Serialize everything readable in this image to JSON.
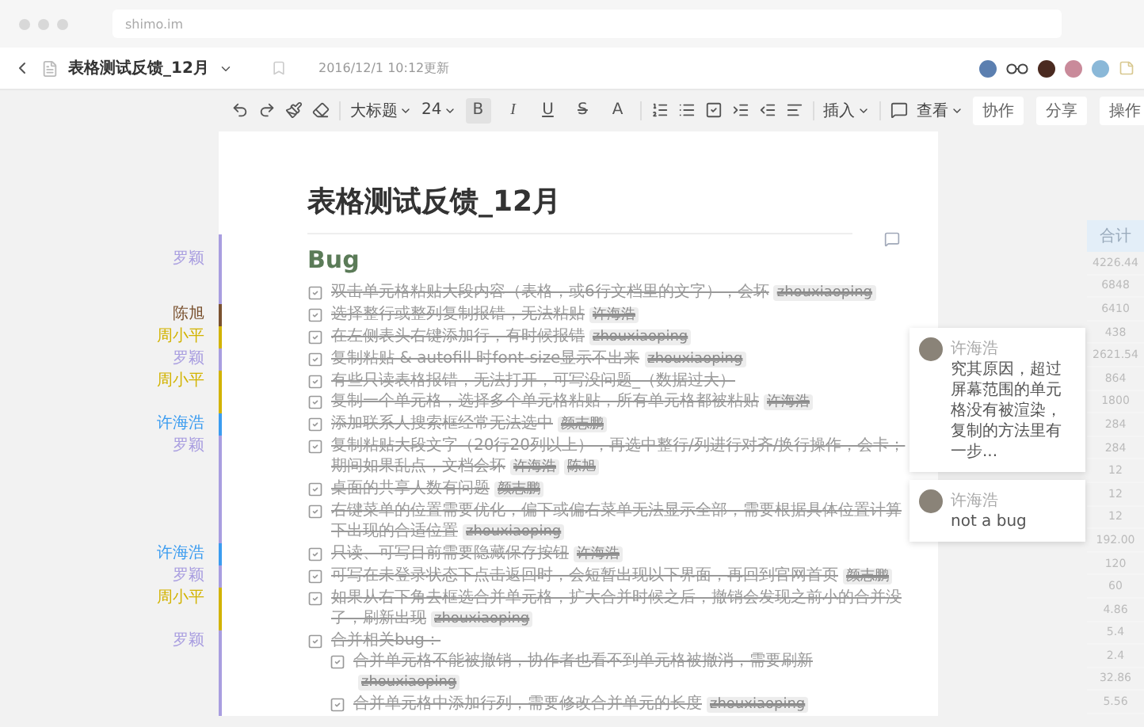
{
  "browser": {
    "url": "shimo.im"
  },
  "header": {
    "title": "表格测试反馈_12月",
    "updated": "2016/12/1 10:12更新"
  },
  "toolbar": {
    "style": "大标题",
    "size": "24",
    "formats": [
      {
        "label": "B",
        "selected": true
      },
      {
        "label": "I",
        "selected": false
      },
      {
        "label": "U",
        "selected": false
      },
      {
        "label": "S",
        "selected": false
      },
      {
        "label": "A",
        "selected": false
      }
    ],
    "insert": "插入",
    "view": "查看",
    "buttons": [
      "协作",
      "分享",
      "操作"
    ]
  },
  "document": {
    "title": "表格测试反馈_12月",
    "heading": {
      "text": "Bug",
      "color": "#a99ee0",
      "author": "罗颖"
    },
    "items": [
      {
        "text": "双击单元格粘贴大段内容（表格，或6行文档里的文字），会坏",
        "checked": true,
        "tags": [
          "zhouxiaoping"
        ],
        "color": "#a99ee0"
      },
      {
        "text": "选择整行或整列复制报错，无法粘贴",
        "checked": true,
        "tags": [
          "许海浩"
        ],
        "color": "#7a5230",
        "author": "陈旭"
      },
      {
        "text": "在左侧表头右键添加行，有时候报错",
        "checked": true,
        "tags": [
          "zhouxiaoping"
        ],
        "color": "#d2b300",
        "author": "周小平"
      },
      {
        "text": "复制粘贴 & autofill 时font-size显示不出来",
        "checked": true,
        "tags": [
          "zhouxiaoping"
        ],
        "color": "#a99ee0",
        "author": "罗颖"
      },
      {
        "text": "有些只读表格报错，无法打开，可写没问题_（数据过大）",
        "checked": true,
        "color": "#d2b300",
        "author": "周小平"
      },
      {
        "text": "复制一个单元格，选择多个单元格粘贴，所有单元格都被粘贴",
        "checked": true,
        "tags": [
          "许海浩"
        ],
        "color": "#d2b300"
      },
      {
        "text": "添加联系人搜索框经常无法选中",
        "checked": true,
        "tags": [
          "颜志鹏"
        ],
        "color": "#3b9cf0",
        "author": "许海浩"
      },
      {
        "text": "复制粘贴大段文字（20行20列以上），再选中整行/列进行对齐/换行操作，会卡；期间如果乱点，文档会坏",
        "checked": true,
        "tags": [
          "许海浩",
          "陈旭"
        ],
        "color": "#a99ee0",
        "author": "罗颖"
      },
      {
        "text": "桌面的共享人数有问题",
        "checked": true,
        "tags": [
          "颜志鹏"
        ],
        "color": "#a99ee0"
      },
      {
        "text": "右键菜单的位置需要优化，偏下或偏右菜单无法显示全部，需要根据具体位置计算下出现的合适位置",
        "checked": true,
        "tags": [
          "zhouxiaoping"
        ],
        "color": "#a99ee0"
      },
      {
        "text": "只读、可写目前需要隐藏保存按钮",
        "checked": true,
        "tags": [
          "许海浩"
        ],
        "color": "#3b9cf0",
        "author": "许海浩"
      },
      {
        "text": "可写在未登录状态下点击返回时，会短暂出现以下界面，再回到官网首页",
        "checked": true,
        "tags": [
          "颜志鹏"
        ],
        "color": "#a99ee0",
        "author": "罗颖"
      },
      {
        "text": "如果从右下角去框选合并单元格，扩大合并时候之后，撤销会发现之前小的合并没了，刷新出现",
        "checked": true,
        "tags": [
          "zhouxiaoping"
        ],
        "color": "#d2b300",
        "author": "周小平"
      },
      {
        "text": "合并相关bug：",
        "checked": true,
        "color": "#a99ee0",
        "author": "罗颖",
        "children": [
          {
            "text": "合并单元格不能被撤销，协作者也看不到单元格被撤消，需要刷新",
            "checked": true,
            "tags": [
              "zhouxiaoping"
            ],
            "color": "#a99ee0"
          },
          {
            "text": "合并单元格中添加行列，需要修改合并单元的长度",
            "checked": true,
            "tags": [
              "zhouxiaoping"
            ],
            "color": "#a99ee0"
          }
        ]
      }
    ]
  },
  "comments": [
    {
      "author": "许海浩",
      "text": "究其原因，超过屏幕范围的单元格没有被渲染，复制的方法里有一步..."
    },
    {
      "author": "许海浩",
      "text": "not a bug"
    }
  ],
  "sheet_column": {
    "header": "合计",
    "values": [
      "4226.44",
      "6848",
      "6410",
      "438",
      "2621.54",
      "864",
      "1800",
      "284",
      "284",
      "12",
      "12",
      "12",
      "192.00",
      "120",
      "60",
      "4.86",
      "5.4",
      "2.4",
      "32.86",
      "5.56"
    ]
  }
}
